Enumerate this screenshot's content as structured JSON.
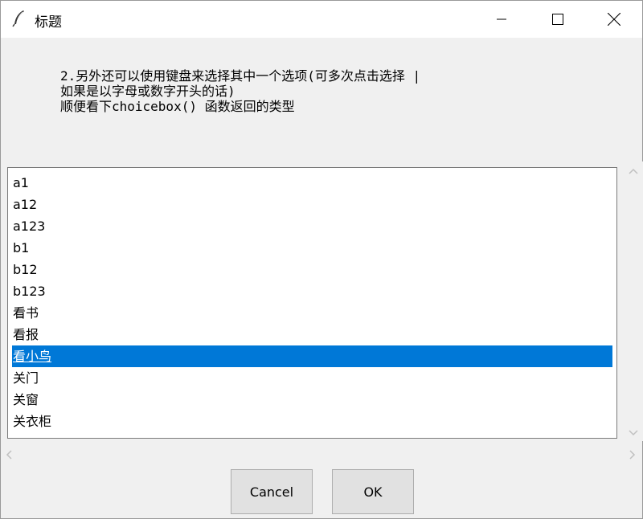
{
  "window": {
    "title": "标题"
  },
  "message": {
    "lines": [
      "2.另外还可以使用键盘来选择其中一个选项(可多次点击选择 |",
      "如果是以字母或数字开头的话)",
      "顺便看下choicebox() 函数返回的类型"
    ]
  },
  "listbox": {
    "items": [
      "a1",
      "a12",
      "a123",
      "b1",
      "b12",
      "b123",
      "看书",
      "看报",
      "看小鸟",
      "关门",
      "关窗",
      "关衣柜"
    ],
    "selected_index": 8
  },
  "buttons": {
    "cancel_label": "Cancel",
    "ok_label": "OK"
  },
  "colors": {
    "selection": "#0078d7",
    "background": "#f0f0f0"
  }
}
